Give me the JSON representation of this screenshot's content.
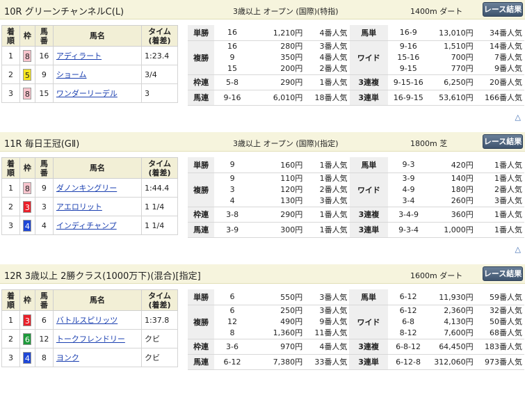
{
  "button_label": "レース結果",
  "pagetop": "△",
  "headers": {
    "chakujun": "着順",
    "waku": "枠",
    "umaban": "馬番",
    "name": "馬名",
    "time": "タイム(着差)"
  },
  "pay_labels": {
    "tansho": "単勝",
    "fukusho": "複勝",
    "wakuren": "枠連",
    "umaren": "馬連",
    "umatan": "馬単",
    "wide": "ワイド",
    "sanrenpuku": "3連複",
    "sanrentan": "3連単"
  },
  "races": [
    {
      "title": "10R グリーンチャンネルC(L)",
      "cond": "3歳以上 オープン (国際)(特指)",
      "dist": "1400m ダート",
      "results": [
        {
          "rank": "1",
          "waku": "8",
          "num": "16",
          "name": "アディラート",
          "time": "1:23.4"
        },
        {
          "rank": "2",
          "waku": "5",
          "num": "9",
          "name": "ショーム",
          "time": "3/4"
        },
        {
          "rank": "3",
          "waku": "8",
          "num": "15",
          "name": "ワンダーリーデル",
          "time": "3"
        }
      ],
      "tansho": {
        "num": "16",
        "yen": "1,210円",
        "pop": "4番人気"
      },
      "fukusho": [
        {
          "num": "16",
          "yen": "280円",
          "pop": "3番人気"
        },
        {
          "num": "9",
          "yen": "350円",
          "pop": "4番人気"
        },
        {
          "num": "15",
          "yen": "200円",
          "pop": "2番人気"
        }
      ],
      "wakuren": {
        "num": "5-8",
        "yen": "290円",
        "pop": "1番人気"
      },
      "umaren": {
        "num": "9-16",
        "yen": "6,010円",
        "pop": "18番人気"
      },
      "umatan": {
        "num": "16-9",
        "yen": "13,010円",
        "pop": "34番人気"
      },
      "wide": [
        {
          "num": "9-16",
          "yen": "1,510円",
          "pop": "14番人気"
        },
        {
          "num": "15-16",
          "yen": "700円",
          "pop": "7番人気"
        },
        {
          "num": "9-15",
          "yen": "770円",
          "pop": "9番人気"
        }
      ],
      "sanrenpuku": {
        "num": "9-15-16",
        "yen": "6,250円",
        "pop": "20番人気"
      },
      "sanrentan": {
        "num": "16-9-15",
        "yen": "53,610円",
        "pop": "166番人気"
      }
    },
    {
      "title": "11R 毎日王冠(GⅡ)",
      "cond": "3歳以上 オープン (国際)(指定)",
      "dist": "1800m 芝",
      "results": [
        {
          "rank": "1",
          "waku": "8",
          "num": "9",
          "name": "ダノンキングリー",
          "time": "1:44.4"
        },
        {
          "rank": "2",
          "waku": "3",
          "num": "3",
          "name": "アエロリット",
          "time": "1 1/4"
        },
        {
          "rank": "3",
          "waku": "4",
          "num": "4",
          "name": "インディチャンプ",
          "time": "1 1/4"
        }
      ],
      "tansho": {
        "num": "9",
        "yen": "160円",
        "pop": "1番人気"
      },
      "fukusho": [
        {
          "num": "9",
          "yen": "110円",
          "pop": "1番人気"
        },
        {
          "num": "3",
          "yen": "120円",
          "pop": "2番人気"
        },
        {
          "num": "4",
          "yen": "130円",
          "pop": "3番人気"
        }
      ],
      "wakuren": {
        "num": "3-8",
        "yen": "290円",
        "pop": "1番人気"
      },
      "umaren": {
        "num": "3-9",
        "yen": "300円",
        "pop": "1番人気"
      },
      "umatan": {
        "num": "9-3",
        "yen": "420円",
        "pop": "1番人気"
      },
      "wide": [
        {
          "num": "3-9",
          "yen": "140円",
          "pop": "1番人気"
        },
        {
          "num": "4-9",
          "yen": "180円",
          "pop": "2番人気"
        },
        {
          "num": "3-4",
          "yen": "260円",
          "pop": "3番人気"
        }
      ],
      "sanrenpuku": {
        "num": "3-4-9",
        "yen": "360円",
        "pop": "1番人気"
      },
      "sanrentan": {
        "num": "9-3-4",
        "yen": "1,000円",
        "pop": "1番人気"
      }
    },
    {
      "title": "12R 3歳以上 2勝クラス(1000万下)(混合)[指定]",
      "cond": "",
      "dist": "1600m ダート",
      "results": [
        {
          "rank": "1",
          "waku": "3",
          "num": "6",
          "name": "バトルスピリッツ",
          "time": "1:37.8"
        },
        {
          "rank": "2",
          "waku": "6",
          "num": "12",
          "name": "トークフレンドリー",
          "time": "クビ"
        },
        {
          "rank": "3",
          "waku": "4",
          "num": "8",
          "name": "ヨンク",
          "time": "クビ"
        }
      ],
      "tansho": {
        "num": "6",
        "yen": "550円",
        "pop": "3番人気"
      },
      "fukusho": [
        {
          "num": "6",
          "yen": "250円",
          "pop": "3番人気"
        },
        {
          "num": "12",
          "yen": "490円",
          "pop": "9番人気"
        },
        {
          "num": "8",
          "yen": "1,360円",
          "pop": "11番人気"
        }
      ],
      "wakuren": {
        "num": "3-6",
        "yen": "970円",
        "pop": "4番人気"
      },
      "umaren": {
        "num": "6-12",
        "yen": "7,380円",
        "pop": "33番人気"
      },
      "umatan": {
        "num": "6-12",
        "yen": "11,930円",
        "pop": "59番人気"
      },
      "wide": [
        {
          "num": "6-12",
          "yen": "2,360円",
          "pop": "32番人気"
        },
        {
          "num": "6-8",
          "yen": "4,130円",
          "pop": "50番人気"
        },
        {
          "num": "8-12",
          "yen": "7,600円",
          "pop": "68番人気"
        }
      ],
      "sanrenpuku": {
        "num": "6-8-12",
        "yen": "64,450円",
        "pop": "183番人気"
      },
      "sanrentan": {
        "num": "6-12-8",
        "yen": "312,060円",
        "pop": "973番人気"
      }
    }
  ],
  "waku_colors": {
    "3": {
      "bg": "#e8202a",
      "fg": "#ffffff"
    },
    "4": {
      "bg": "#1f47d6",
      "fg": "#ffffff"
    },
    "5": {
      "bg": "#f5e521",
      "fg": "#222222"
    },
    "6": {
      "bg": "#1e9a3b",
      "fg": "#ffffff"
    },
    "8": {
      "bg": "#f7c4cd",
      "fg": "#222222"
    }
  }
}
